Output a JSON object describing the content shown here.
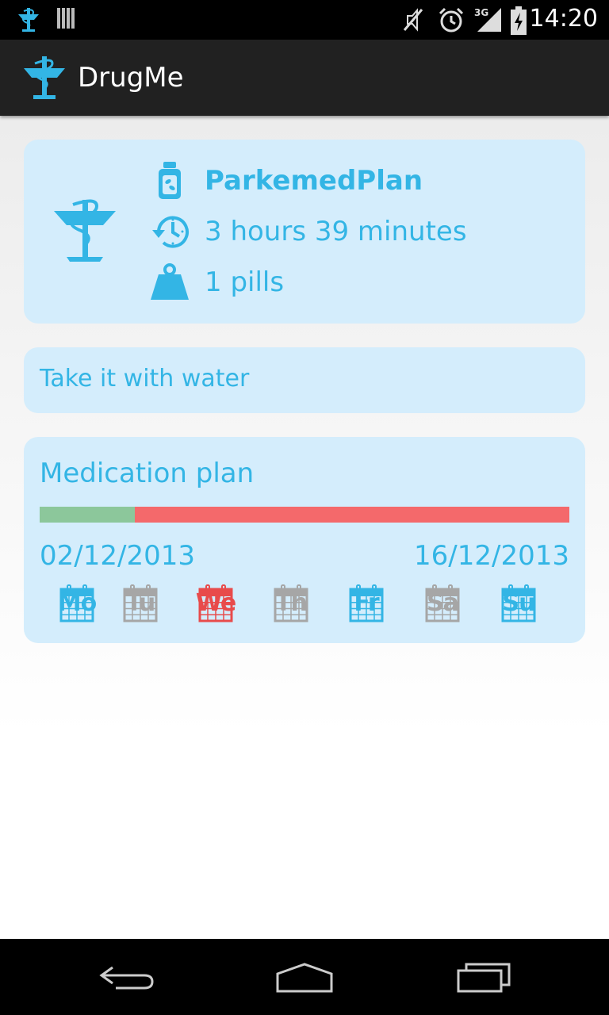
{
  "status_bar": {
    "time": "14:20",
    "icons": [
      "app-notification-icon",
      "barcode-icon",
      "muted-icon",
      "alarm-icon",
      "signal-3g-icon",
      "battery-charging-icon"
    ],
    "network": "3G"
  },
  "action_bar": {
    "title": "DrugMe",
    "icon": "caduceus-icon"
  },
  "drug": {
    "name": "ParkemedPlan",
    "interval": "3 hours 39 minutes",
    "dose": "1 pills"
  },
  "note": {
    "text": "Take it with water"
  },
  "plan": {
    "title": "Medication plan",
    "progress": 0.18,
    "start_date": "02/12/2013",
    "end_date": "16/12/2013",
    "days": [
      {
        "label": "Mo",
        "state": "active"
      },
      {
        "label": "Tu",
        "state": "inactive"
      },
      {
        "label": "We",
        "state": "today"
      },
      {
        "label": "Th",
        "state": "inactive"
      },
      {
        "label": "Fr",
        "state": "active"
      },
      {
        "label": "Sa",
        "state": "inactive"
      },
      {
        "label": "Su",
        "state": "active"
      }
    ],
    "colors": {
      "active": "#33b5e5",
      "inactive": "#a6a6a6",
      "today": "#e84b4b",
      "progress_done": "#8cc79b",
      "progress_remaining": "#f4696b"
    }
  },
  "nav_bar": {
    "buttons": [
      "back-icon",
      "home-icon",
      "recents-icon"
    ]
  }
}
